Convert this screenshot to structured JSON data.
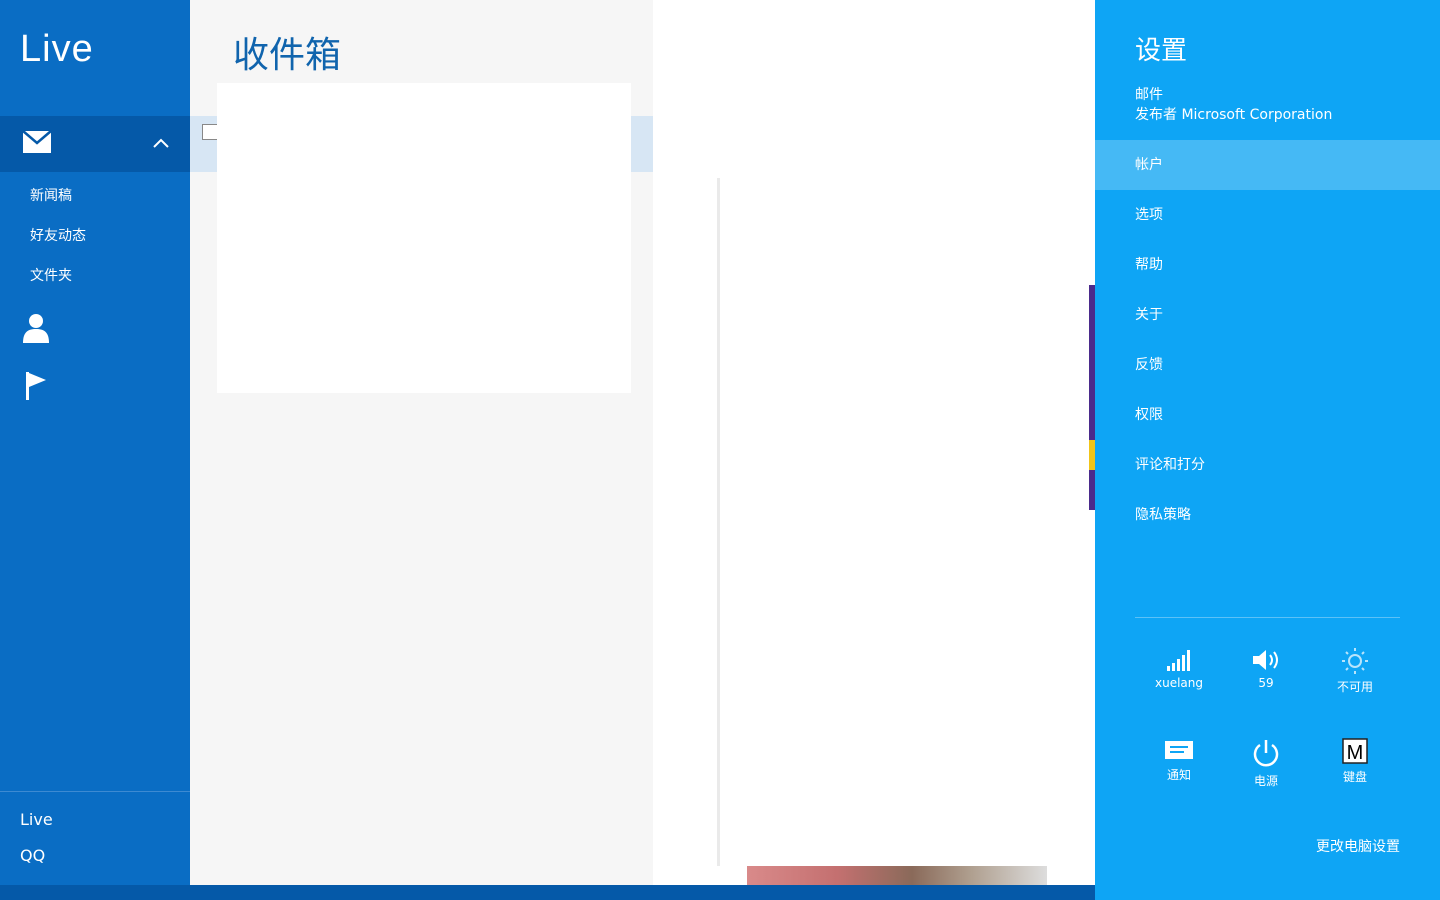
{
  "left_nav": {
    "account_title": "Live",
    "folders": [
      "新闻稿",
      "好友动态",
      "文件夹"
    ],
    "accounts": [
      "Live",
      "QQ"
    ],
    "icons": {
      "mail": "mail-icon",
      "collapse": "chevron-up-icon",
      "people": "person-icon",
      "flag": "flag-icon"
    }
  },
  "message_list": {
    "folder_title": "收件箱"
  },
  "settings": {
    "title": "设置",
    "app_name": "邮件",
    "publisher": "发布者 Microsoft Corporation",
    "items": [
      "帐户",
      "选项",
      "帮助",
      "关于",
      "反馈",
      "权限",
      "评论和打分",
      "隐私策略"
    ],
    "selected_item": "帐户",
    "tiles": [
      {
        "icon": "network-signal-icon",
        "label": "xuelang"
      },
      {
        "icon": "volume-icon",
        "label": "59"
      },
      {
        "icon": "brightness-icon",
        "label": "不可用"
      },
      {
        "icon": "notifications-icon",
        "label": "通知"
      },
      {
        "icon": "power-icon",
        "label": "电源"
      },
      {
        "icon": "keyboard-icon",
        "label": "键盘"
      }
    ],
    "change_pc_settings": "更改电脑设置"
  },
  "colors": {
    "nav_bg": "#0a6dc4",
    "nav_selected": "#0559a8",
    "charm_bg": "#0ea5f5",
    "charm_selected": "#45b9f5",
    "folder_title": "#1064ad"
  }
}
